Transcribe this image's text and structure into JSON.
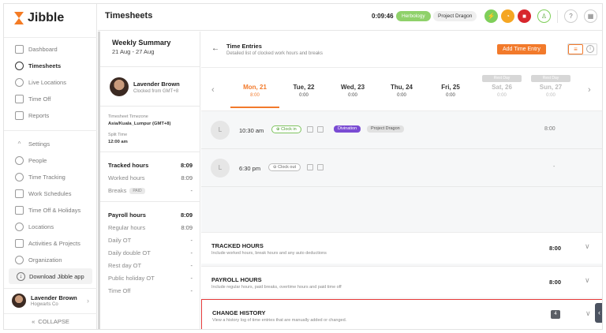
{
  "app": {
    "brand": "Jibble",
    "page_title": "Timesheets"
  },
  "topbar": {
    "timer": "0:09:46",
    "activity_pill": "Herbology",
    "project_pill": "Project Dragon",
    "icons": [
      "lightning-icon",
      "timer-icon",
      "stop-icon",
      "user-add-icon",
      "help-icon",
      "notifications-icon"
    ],
    "accent_green": "#7fcf5a",
    "accent_orange": "#f5a623",
    "accent_red": "#d8262c"
  },
  "sidebar": {
    "items": [
      {
        "label": "Dashboard",
        "icon": "dashboard-icon"
      },
      {
        "label": "Timesheets",
        "icon": "clock-icon",
        "active": true
      },
      {
        "label": "Live Locations",
        "icon": "location-pin-icon"
      },
      {
        "label": "Time Off",
        "icon": "calendar-icon"
      },
      {
        "label": "Reports",
        "icon": "report-icon"
      }
    ],
    "settings_items": [
      {
        "label": "Settings",
        "icon": "settings-chevron-icon"
      },
      {
        "label": "People",
        "icon": "people-icon"
      },
      {
        "label": "Time Tracking",
        "icon": "time-tracking-icon"
      },
      {
        "label": "Work Schedules",
        "icon": "schedule-icon"
      },
      {
        "label": "Time Off & Holidays",
        "icon": "holiday-icon"
      },
      {
        "label": "Locations",
        "icon": "locations-icon"
      },
      {
        "label": "Activities & Projects",
        "icon": "tag-icon"
      },
      {
        "label": "Organization",
        "icon": "gear-icon"
      }
    ],
    "download_label": "Download Jibble app",
    "profile": {
      "name": "Lavender Brown",
      "org": "Hogwarts Co"
    },
    "collapse_label": "COLLAPSE"
  },
  "summary": {
    "title": "Weekly Summary",
    "range": "21 Aug - 27 Aug",
    "employee": {
      "name": "Lavender Brown",
      "sub": "Clocked from GMT+8"
    },
    "timezone_label": "Timesheet Timezone",
    "timezone_value": "Asia/Kuala_Lumpur (GMT+8)",
    "split_label": "Split Time",
    "split_value": "12:00 am",
    "tracked": [
      {
        "label": "Tracked hours",
        "value": "8:09",
        "bold": true
      },
      {
        "label": "Worked hours",
        "value": "8:09"
      },
      {
        "label": "Breaks",
        "value": "-",
        "tag": "PAID"
      }
    ],
    "payroll": [
      {
        "label": "Payroll hours",
        "value": "8:09",
        "bold": true
      },
      {
        "label": "Regular hours",
        "value": "8:09"
      },
      {
        "label": "Daily OT",
        "value": "-"
      },
      {
        "label": "Daily double OT",
        "value": "-"
      },
      {
        "label": "Rest day OT",
        "value": "-"
      },
      {
        "label": "Public holiday OT",
        "value": "-"
      },
      {
        "label": "Time Off",
        "value": "-"
      }
    ]
  },
  "time_entries": {
    "title": "Time Entries",
    "subtitle": "Detailed list of clocked work hours and breaks",
    "add_button": "Add Time Entry",
    "days": [
      {
        "name": "Mon, 21",
        "value": "8:00",
        "active": true
      },
      {
        "name": "Tue, 22",
        "value": "0:00"
      },
      {
        "name": "Wed, 23",
        "value": "0:00"
      },
      {
        "name": "Thu, 24",
        "value": "0:00"
      },
      {
        "name": "Fri, 25",
        "value": "0:00"
      },
      {
        "name": "Sat, 26",
        "value": "0:00",
        "rest": "Rest Day"
      },
      {
        "name": "Sun, 27",
        "value": "0:00",
        "rest": "Rest Day"
      }
    ],
    "entries": [
      {
        "initial": "L",
        "time": "10:30 am",
        "type": "Clock in",
        "activity": "Divination",
        "project": "Project Dragon",
        "duration": "8:00"
      },
      {
        "initial": "L",
        "time": "6:30 pm",
        "type": "Clock out",
        "duration": "-"
      }
    ]
  },
  "sections": [
    {
      "title": "TRACKED HOURS",
      "subtitle": "Include worked hours, break hours and any auto deductions",
      "value": "8:00"
    },
    {
      "title": "PAYROLL HOURS",
      "subtitle": "Include regular hours, paid breaks, overtime hours and paid time off",
      "value": "8:00"
    },
    {
      "title": "CHANGE HISTORY",
      "subtitle": "View a history log of time entries that are manually added or changed.",
      "count": "4",
      "highlight_color": "#e53a3a"
    }
  ]
}
